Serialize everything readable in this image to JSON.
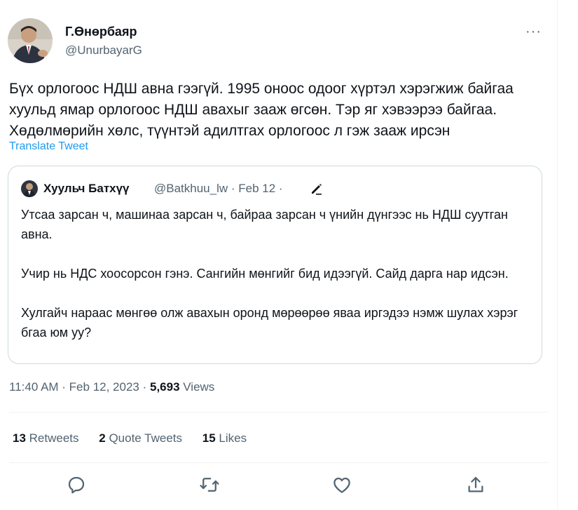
{
  "tweet": {
    "author_name": "Г.Өнөрбаяр",
    "author_handle": "@UnurbayarG",
    "more_label": "···",
    "text": "Бүх орлогоос НДШ авна гээгүй. 1995 оноос одоог хүртэл хэрэгжиж байгаа хуульд ямар орлогоос НДШ авахыг зааж өгсөн. Тэр яг хэвээрээ байгаа. Хөдөлмөрийн хөлс, түүнтэй адилтгах орлогоос л гэж зааж ирсэн",
    "translate_label": "Translate Tweet",
    "time": "11:40 AM · Feb 12, 2023 · ",
    "views_count": "5,693",
    "views_label": " Views"
  },
  "quote": {
    "name": "Хуульч Батхүү",
    "meta": "@Batkhuu_lw · Feb 12 ·",
    "paragraphs": [
      "Утсаа зарсан ч, машинаа зарсан ч, байраа зарсан ч үнийн дүнгээс нь НДШ суутган авна.",
      "Учир нь НДС хоосорсон гэнэ. Сангийн мөнгийг бид идээгүй. Сайд дарга нар идсэн.",
      "Хулгайч нараас мөнгөө олж авахын оронд мөрөөрөө яваа иргэдээ нэмж шулах хэрэг бгаа юм уу?"
    ]
  },
  "stats": {
    "retweets_count": "13",
    "retweets_label": " Retweets",
    "quotes_count": "2",
    "quotes_label": " Quote Tweets",
    "likes_count": "15",
    "likes_label": " Likes"
  },
  "icons": {
    "reply": "reply-icon",
    "retweet": "retweet-icon",
    "like": "like-icon",
    "share": "share-icon",
    "edit": "edit-icon"
  },
  "colors": {
    "link": "#1d9bf0",
    "secondary_text": "#536471",
    "primary_text": "#0f1419",
    "border": "#cfd9de"
  }
}
